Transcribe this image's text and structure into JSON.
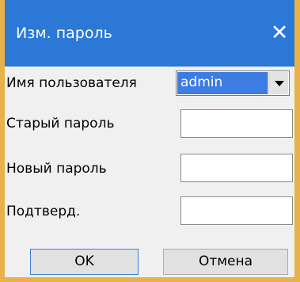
{
  "dialog": {
    "title": "Изм. пароль",
    "close_icon": "close-icon",
    "close_glyph": "✕"
  },
  "form": {
    "username_label": "Имя пользователя",
    "username_value": "admin",
    "old_password_label": "Старый пароль",
    "new_password_label": "Новый пароль",
    "confirm_label": "Подтверд."
  },
  "buttons": {
    "ok_label": "OK",
    "cancel_label": "Отмена"
  },
  "colors": {
    "titlebar": "#2b78d6",
    "selection": "#3d7ce3",
    "window_bg": "#f0f0f0",
    "outer_frame": "#e7b24a"
  }
}
